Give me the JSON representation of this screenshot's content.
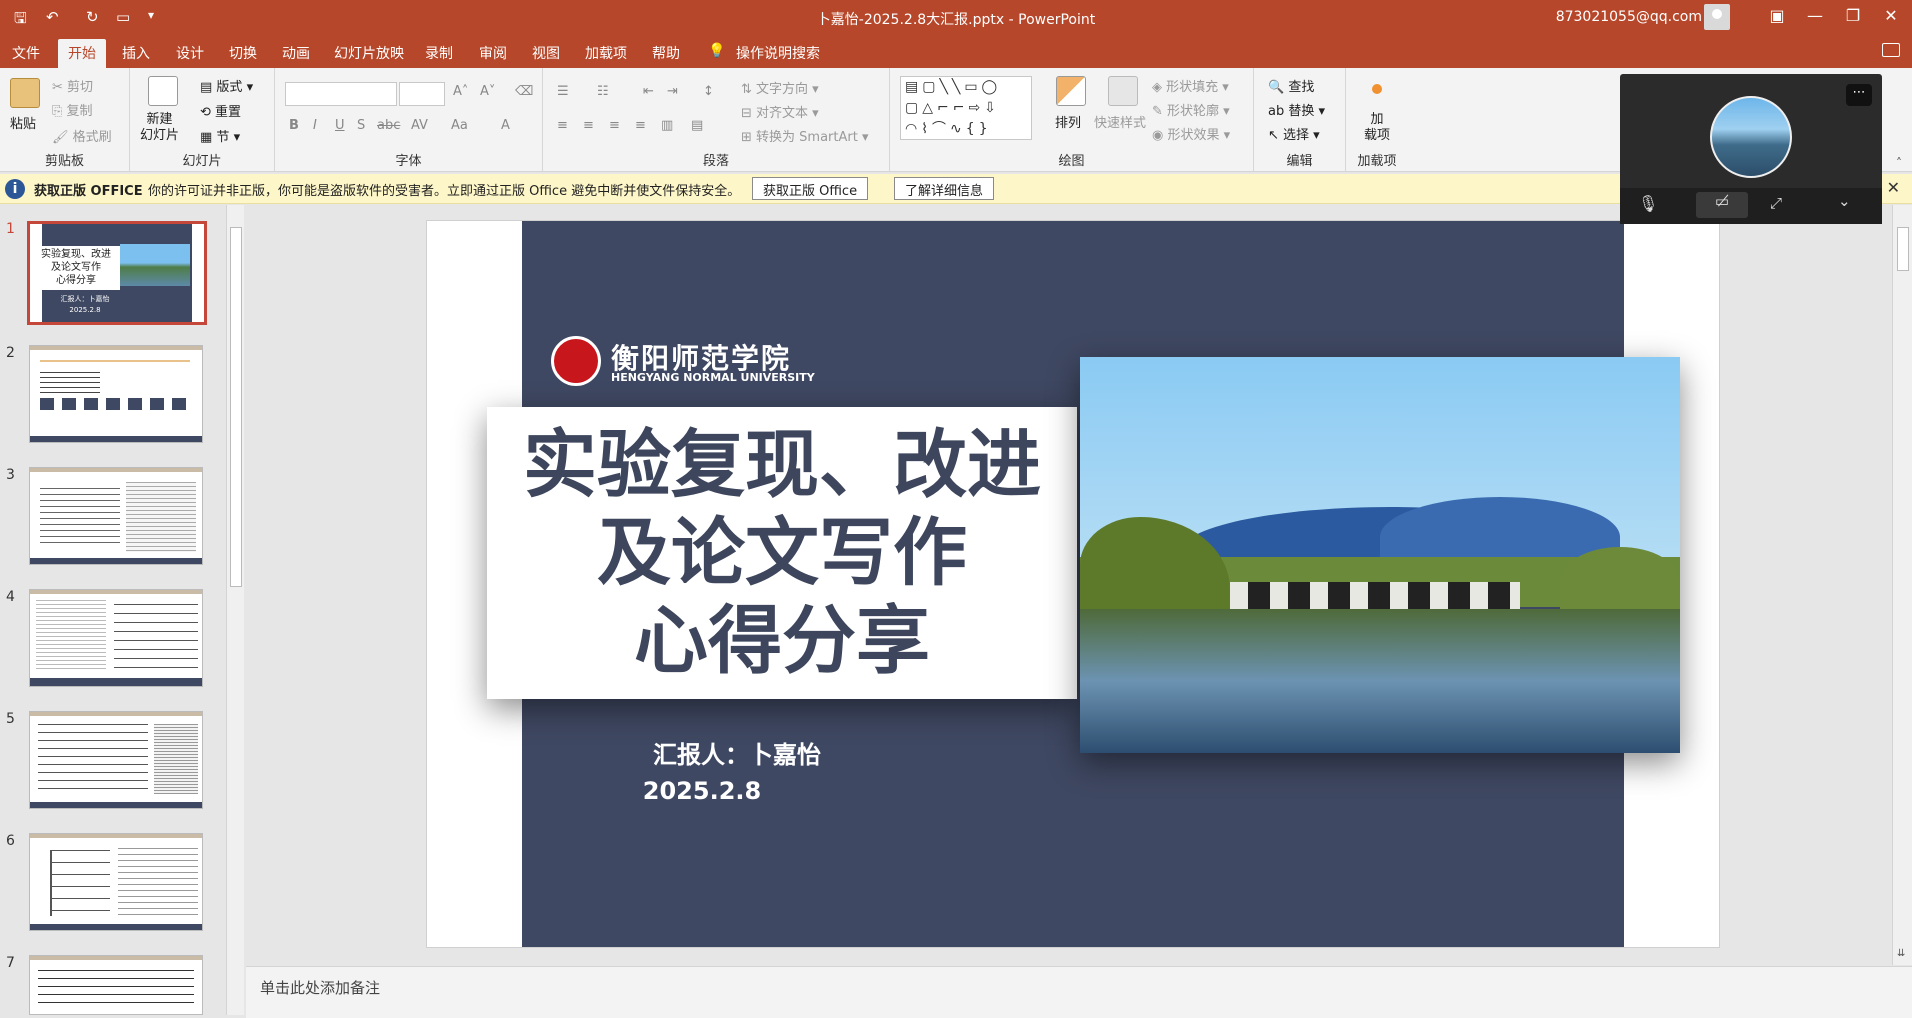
{
  "titlebar": {
    "title": "卜嘉怡-2025.2.8大汇报.pptx  -  PowerPoint",
    "account": "873021055@qq.com"
  },
  "tabs": [
    "文件",
    "开始",
    "插入",
    "设计",
    "切换",
    "动画",
    "幻灯片放映",
    "录制",
    "审阅",
    "视图",
    "加载项",
    "帮助",
    "操作说明搜索"
  ],
  "ribbon": {
    "clipboard": {
      "label": "剪贴板",
      "paste": "粘贴",
      "cut": "剪切",
      "copy": "复制",
      "format_painter": "格式刷"
    },
    "slides": {
      "label": "幻灯片",
      "new_slide": "新建\n幻灯片",
      "layout": "版式",
      "reset": "重置",
      "section": "节"
    },
    "font": {
      "label": "字体"
    },
    "paragraph": {
      "label": "段落",
      "text_direction": "文字方向",
      "align_text": "对齐文本",
      "smartart": "转换为 SmartArt"
    },
    "drawing": {
      "label": "绘图",
      "arrange": "排列",
      "quick_styles": "快速样式",
      "shape_fill": "形状填充",
      "shape_outline": "形状轮廓",
      "shape_effects": "形状效果"
    },
    "editing": {
      "label": "编辑",
      "find": "查找",
      "replace": "替换",
      "select": "选择"
    },
    "addins": {
      "label": "加载项",
      "addin": "加\n载项"
    }
  },
  "message": {
    "title": "获取正版 OFFICE",
    "text": "你的许可证并非正版，你可能是盗版软件的受害者。立即通过正版 Office 避免中断并使文件保持安全。",
    "btn_get": "获取正版 Office",
    "btn_more": "了解详细信息"
  },
  "thumbnails": {
    "numbers": [
      "1",
      "2",
      "3",
      "4",
      "5",
      "6",
      "7"
    ],
    "t1_title": "实验复现、改进\n及论文写作\n心得分享",
    "t1_reporter": "汇报人：卜嘉怡",
    "t1_date": "2025.2.8"
  },
  "slide": {
    "school_cn": "衡阳师范学院",
    "school_en": "HENGYANG NORMAL UNIVERSITY",
    "title_line1": "实验复现、改进",
    "title_line2": "及论文写作",
    "title_line3": "心得分享",
    "reporter": "汇报人：卜嘉怡",
    "date": "2025.2.8"
  },
  "notes": {
    "placeholder": "单击此处添加备注"
  },
  "colors": {
    "accent": "#b7472a",
    "slide_navy": "#3f4862",
    "title_text": "#3d465c"
  }
}
